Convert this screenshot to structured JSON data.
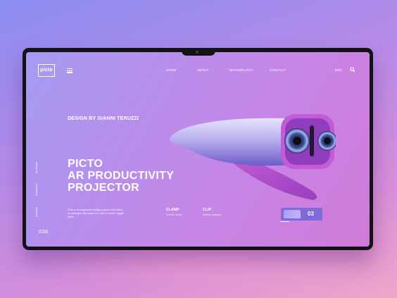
{
  "brand": {
    "logo_text": "picto"
  },
  "nav": {
    "items": [
      {
        "label": "HOME"
      },
      {
        "label": "ABOUT"
      },
      {
        "label": "TECHNOLOGY"
      },
      {
        "label": "CONTACT"
      }
    ],
    "language": "ENG"
  },
  "hero": {
    "designer": "DESIGN BY GIANNI TERUZZI",
    "title_lines": [
      "PICTO",
      "AR PRODUCTIVITY",
      "PROJECTOR"
    ],
    "description": "Picto is an augmented reality projector that offers an analogue alternative to a 'just on screen' digital office."
  },
  "social": [
    {
      "label": "facebook"
    },
    {
      "label": "instagram"
    },
    {
      "label": "youtube"
    }
  ],
  "features": [
    {
      "title": "CLAMP",
      "subtitle": "it on the screen"
    },
    {
      "title": "CLIP",
      "subtitle": "it to the notebook"
    }
  ],
  "counter": "035",
  "slider": {
    "current": "03"
  },
  "colors": {
    "accent": "#7d6cd8",
    "frame": "#121217",
    "screen_start": "#a59bf2",
    "screen_end": "#d07ad8"
  }
}
